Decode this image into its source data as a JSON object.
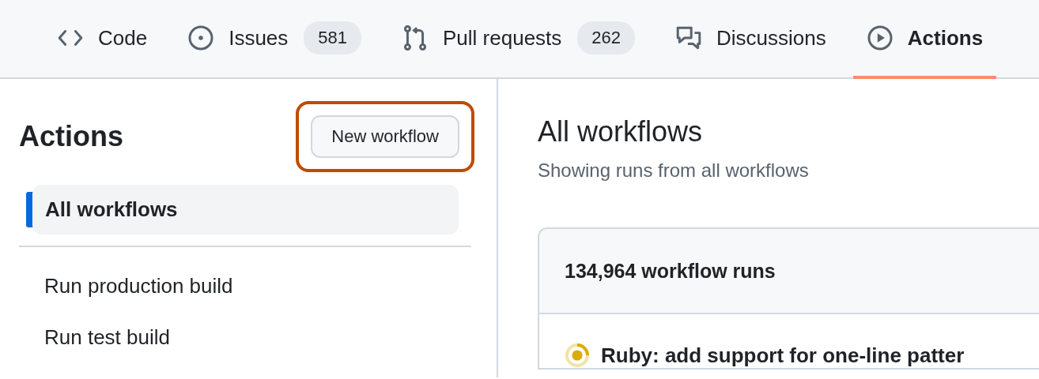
{
  "tabs": [
    {
      "kind": "code",
      "label": "Code",
      "selected": false
    },
    {
      "kind": "issue",
      "label": "Issues",
      "count": "581",
      "selected": false
    },
    {
      "kind": "pull",
      "label": "Pull requests",
      "count": "262",
      "selected": false
    },
    {
      "kind": "discussion",
      "label": "Discussions",
      "selected": false
    },
    {
      "kind": "play",
      "label": "Actions",
      "selected": true
    }
  ],
  "sidebar": {
    "title": "Actions",
    "button": "New workflow",
    "items": [
      {
        "label": "All workflows",
        "selected": true
      },
      {
        "label": "Run production build",
        "selected": false
      },
      {
        "label": "Run test build",
        "selected": false
      }
    ]
  },
  "main": {
    "title": "All workflows",
    "subtitle": "Showing runs from all workflows",
    "runs_count": "134,964 workflow runs",
    "runs": [
      {
        "title": "Ruby: add support for one-line patter",
        "kind": "in_progress"
      }
    ]
  }
}
